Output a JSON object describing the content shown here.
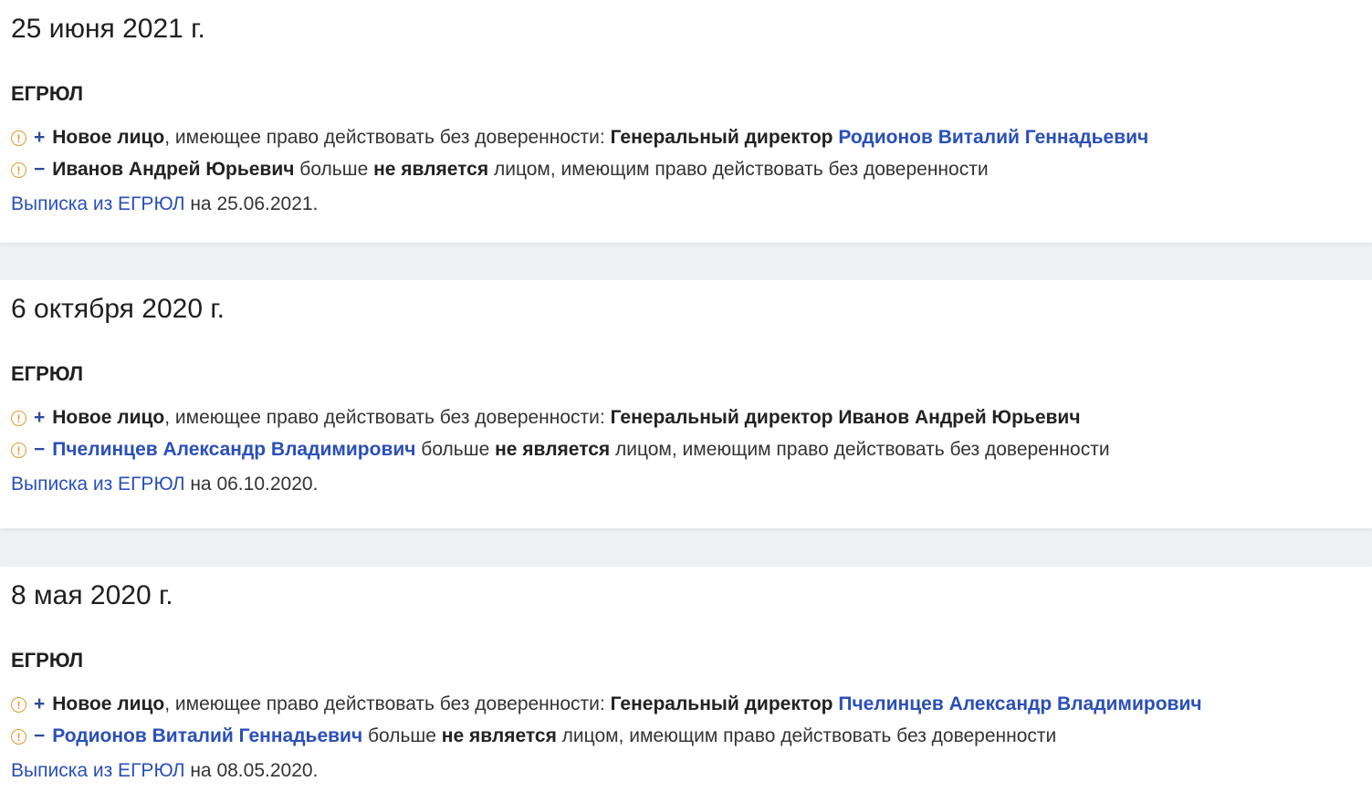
{
  "events": [
    {
      "date": "25 июня 2021 г.",
      "source": "ЕГРЮЛ",
      "added": {
        "warn_icon": "warning-circle-icon",
        "sign": "+",
        "label_bold": "Новое лицо",
        "text": ", имеющее право действовать без доверенности: ",
        "position": "Генеральный директор",
        "name": "Родионов Виталий Геннадьевич"
      },
      "removed": {
        "warn_icon": "warning-circle-icon",
        "sign": "−",
        "name": "Иванов Андрей Юрьевич",
        "text_before": " больше ",
        "not_label": "не является",
        "text_after": " лицом, имеющим право действовать без доверенности"
      },
      "extract": {
        "link": "Выписка из ЕГРЮЛ",
        "suffix": " на 25.06.2021."
      }
    },
    {
      "date": "6 октября 2020 г.",
      "source": "ЕГРЮЛ",
      "added": {
        "warn_icon": "warning-circle-icon",
        "sign": "+",
        "label_bold": "Новое лицо",
        "text": ", имеющее право действовать без доверенности: ",
        "position": "Генеральный директор",
        "name": "Иванов Андрей Юрьевич"
      },
      "removed": {
        "warn_icon": "warning-circle-icon",
        "sign": "−",
        "name": "Пчелинцев Александр Владимирович",
        "text_before": " больше ",
        "not_label": "не является",
        "text_after": " лицом, имеющим право действовать без доверенности"
      },
      "extract": {
        "link": "Выписка из ЕГРЮЛ",
        "suffix": " на 06.10.2020."
      }
    },
    {
      "date": "8 мая 2020 г.",
      "source": "ЕГРЮЛ",
      "added": {
        "warn_icon": "warning-circle-icon",
        "sign": "+",
        "label_bold": "Новое лицо",
        "text": ", имеющее право действовать без доверенности: ",
        "position": "Генеральный директор",
        "name": "Пчелинцев Александр Владимирович"
      },
      "removed": {
        "warn_icon": "warning-circle-icon",
        "sign": "−",
        "name": "Родионов Виталий Геннадьевич",
        "text_before": " больше ",
        "not_label": "не является",
        "text_after": " лицом, имеющим право действовать без доверенности"
      },
      "extract": {
        "link": "Выписка из ЕГРЮЛ",
        "suffix": " на 08.05.2020."
      }
    }
  ],
  "colors": {
    "link": "#2a4fb8",
    "warning": "#e39a2c",
    "sign": "#2f4b9a",
    "page_bg": "#eef0f3"
  }
}
